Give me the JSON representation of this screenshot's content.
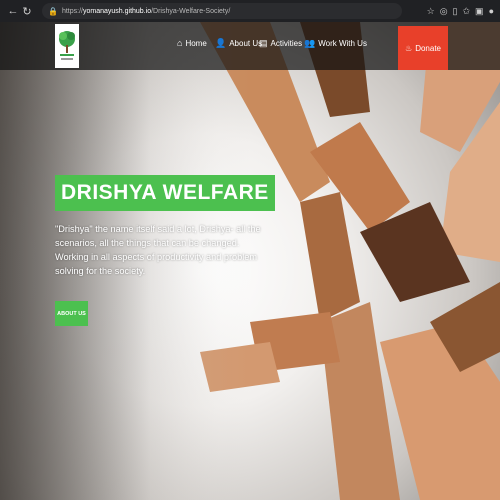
{
  "browser": {
    "url_prefix": "https://",
    "url_host": "yomanayush.github.io",
    "url_path": "/Drishya-Welfare-Society/"
  },
  "nav": {
    "items": [
      {
        "label": "Home",
        "icon": "home-icon"
      },
      {
        "label": "About Us",
        "icon": "user-icon"
      },
      {
        "label": "Activities",
        "icon": "book-icon"
      },
      {
        "label": "Work With Us",
        "icon": "people-icon"
      }
    ],
    "donate_label": "Donate",
    "donate_icon": "donate-icon"
  },
  "hero": {
    "title": "DRISHYA WELFARE",
    "description": "\"Drishya\" the name itself said a lot, Drishya- all the scenarios, all the things that can be changed. Working in all aspects of productivity and problem solving for the society.",
    "button_label": "ABOUT US"
  },
  "colors": {
    "accent_green": "#4cc04f",
    "donate_red": "#e8402a",
    "navbar": "#141414"
  }
}
